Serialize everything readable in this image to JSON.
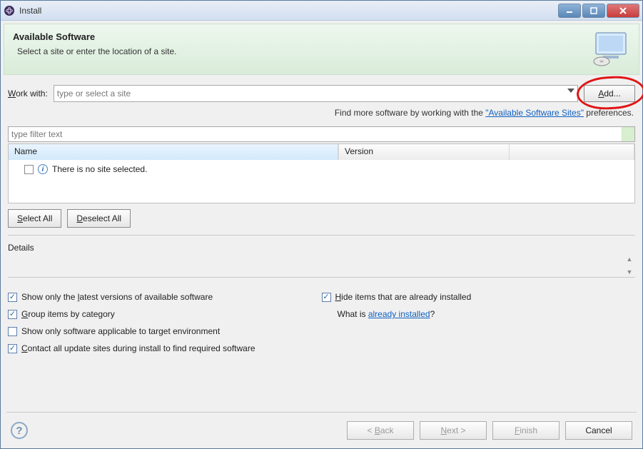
{
  "window": {
    "title": "Install"
  },
  "header": {
    "title": "Available Software",
    "subtitle": "Select a site or enter the location of a site."
  },
  "workwith": {
    "label": "Work with:",
    "placeholder": "type or select a site",
    "add_label": "Add..."
  },
  "findmore": {
    "prefix": "Find more software by working with the ",
    "link": "\"Available Software Sites\"",
    "suffix": " preferences."
  },
  "filter": {
    "placeholder": "type filter text"
  },
  "table": {
    "col_name": "Name",
    "col_version": "Version",
    "empty_msg": "There is no site selected."
  },
  "buttons": {
    "select_all": "Select All",
    "deselect_all": "Deselect All"
  },
  "details": {
    "label": "Details"
  },
  "options": {
    "show_latest": "Show only the latest versions of available software",
    "group_by_category": "Group items by category",
    "show_applicable": "Show only software applicable to target environment",
    "contact_all": "Contact all update sites during install to find required software",
    "hide_installed": "Hide items that are already installed",
    "whatis_prefix": "What is ",
    "whatis_link": "already installed",
    "whatis_suffix": "?"
  },
  "nav": {
    "back": "< Back",
    "next": "Next >",
    "finish": "Finish",
    "cancel": "Cancel"
  }
}
